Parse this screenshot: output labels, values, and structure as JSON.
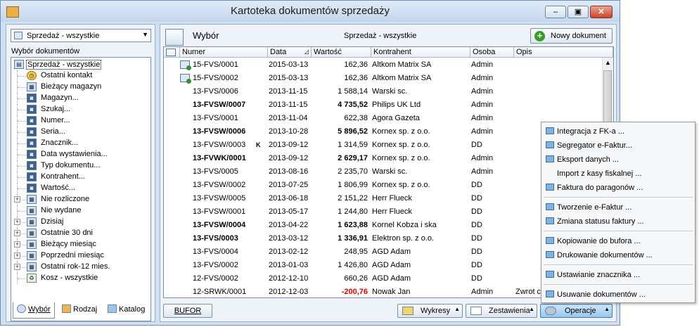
{
  "window": {
    "title": "Kartoteka dokumentów sprzedaży",
    "min_label": "▭",
    "max_label": "□",
    "close_label": "✕"
  },
  "left": {
    "combo_value": "Sprzedaż - wszystkie",
    "section_label": "Wybór dokumentów",
    "tree": [
      {
        "label": "Sprzedaż - wszystkie",
        "icon": "list-icon",
        "selected": true
      },
      {
        "label": "Ostatni kontakt",
        "icon": "clock-icon"
      },
      {
        "label": "Bieżący magazyn",
        "icon": "grid-icon"
      },
      {
        "label": "Magazyn...",
        "icon": "binoculars-icon"
      },
      {
        "label": "Szukaj...",
        "icon": "binoculars-icon"
      },
      {
        "label": "Numer...",
        "icon": "binoculars-icon"
      },
      {
        "label": "Seria...",
        "icon": "binoculars-icon"
      },
      {
        "label": "Znacznik...",
        "icon": "binoculars-icon"
      },
      {
        "label": "Data wystawienia...",
        "icon": "binoculars-icon"
      },
      {
        "label": "Typ dokumentu...",
        "icon": "binoculars-icon"
      },
      {
        "label": "Kontrahent...",
        "icon": "binoculars-icon"
      },
      {
        "label": "Wartość...",
        "icon": "binoculars-icon"
      },
      {
        "label": "Nie rozliczone",
        "icon": "grid-icon",
        "expand": true
      },
      {
        "label": "Nie wydane",
        "icon": "grid-icon"
      },
      {
        "label": "Dzisiaj",
        "icon": "grid-icon",
        "expand": true
      },
      {
        "label": "Ostatnie 30 dni",
        "icon": "grid-icon",
        "expand": true
      },
      {
        "label": "Bieżący miesiąc",
        "icon": "grid-icon",
        "expand": true
      },
      {
        "label": "Poprzedni miesiąc",
        "icon": "grid-icon",
        "expand": true
      },
      {
        "label": "Ostatni rok-12 mies.",
        "icon": "grid-icon",
        "expand": true
      },
      {
        "label": "Kosz - wszystkie",
        "icon": "recycle-bin-icon"
      }
    ],
    "tabs": {
      "wybor": "Wybór",
      "rodzaj": "Rodzaj",
      "katalog": "Katalog"
    }
  },
  "main": {
    "title": "Wybór",
    "subtitle": "Sprzedaż - wszystkie",
    "new_doc_label": "Nowy dokument",
    "columns": [
      "Numer",
      "Data",
      "Wartość",
      "Kontrahent",
      "Osoba",
      "Opis"
    ],
    "rows": [
      {
        "num": "15-FVS/0001",
        "date": "2015-03-13",
        "val": "162,36",
        "kon": "Altkom Matrix SA",
        "os": "Admin",
        "opis": "",
        "bold": false,
        "icon": true
      },
      {
        "num": "15-FVS/0002",
        "date": "2015-03-13",
        "val": "162,36",
        "kon": "Altkom Matrix SA",
        "os": "Admin",
        "opis": "",
        "bold": false,
        "icon": true
      },
      {
        "num": "13-FVS/0006",
        "date": "2013-11-15",
        "val": "1 588,14",
        "kon": "Warski sc.",
        "os": "Admin",
        "opis": "",
        "bold": false
      },
      {
        "num": "13-FVSW/0007",
        "date": "2013-11-15",
        "val": "4 735,52",
        "kon": "Philips UK Ltd",
        "os": "Admin",
        "opis": "",
        "bold": true
      },
      {
        "num": "13-FVS/0001",
        "date": "2013-11-04",
        "val": "622,38",
        "kon": "Agora Gazeta",
        "os": "Admin",
        "opis": "",
        "bold": false
      },
      {
        "num": "13-FVSW/0006",
        "date": "2013-10-28",
        "val": "5 896,52",
        "kon": "Kornex sp. z o.o.",
        "os": "Admin",
        "opis": "",
        "bold": true
      },
      {
        "num": "13-FVSW/0003",
        "date": "2013-09-12",
        "val": "1 314,59",
        "kon": "Kornex sp. z o.o.",
        "os": "DD",
        "opis": "",
        "bold": false,
        "mark": "K"
      },
      {
        "num": "13-FVWK/0001",
        "date": "2013-09-12",
        "val": "2 629,17",
        "kon": "Kornex sp. z o.o.",
        "os": "Admin",
        "opis": "",
        "bold": true
      },
      {
        "num": "13-FVS/0005",
        "date": "2013-08-16",
        "val": "2 235,70",
        "kon": "Warski sc.",
        "os": "Admin",
        "opis": "",
        "bold": false
      },
      {
        "num": "13-FVSW/0002",
        "date": "2013-07-25",
        "val": "1 806,99",
        "kon": "Kornex sp. z o.o.",
        "os": "DD",
        "opis": "",
        "bold": false
      },
      {
        "num": "13-FVSW/0005",
        "date": "2013-06-18",
        "val": "2 151,22",
        "kon": "Herr Flueck",
        "os": "DD",
        "opis": "",
        "bold": false
      },
      {
        "num": "13-FVSW/0001",
        "date": "2013-05-17",
        "val": "1 244,80",
        "kon": "Herr Flueck",
        "os": "DD",
        "opis": "",
        "bold": false
      },
      {
        "num": "13-FVSW/0004",
        "date": "2013-04-22",
        "val": "1 623,88",
        "kon": "Kornel Kobza i ska",
        "os": "DD",
        "opis": "",
        "bold": true
      },
      {
        "num": "13-FVS/0003",
        "date": "2013-03-12",
        "val": "1 336,91",
        "kon": "Elektron sp. z o.o.",
        "os": "DD",
        "opis": "",
        "bold": true
      },
      {
        "num": "13-FVS/0004",
        "date": "2013-02-12",
        "val": "248,95",
        "kon": "AGD Adam",
        "os": "DD",
        "opis": "",
        "bold": false
      },
      {
        "num": "13-FVS/0002",
        "date": "2013-01-03",
        "val": "1 426,80",
        "kon": "AGD Adam",
        "os": "DD",
        "opis": "",
        "bold": false
      },
      {
        "num": "12-FVS/0002",
        "date": "2012-12-10",
        "val": "660,26",
        "kon": "AGD Adam",
        "os": "DD",
        "opis": "",
        "bold": false
      },
      {
        "num": "12-SRWK/0001",
        "date": "2012-12-03",
        "val": "-200,76",
        "kon": "Nowak Jan",
        "os": "Admin",
        "opis": "Zwrot c",
        "bold": false,
        "negative": true
      }
    ],
    "buttons": {
      "bufor": "BUFOR",
      "wykresy": "Wykresy",
      "zestawienia": "Zestawienia",
      "operacje": "Operacje"
    }
  },
  "menu": {
    "items": [
      {
        "label": "Integracja z FK-a ...",
        "icon": true
      },
      {
        "label": "Segregator e-Faktur...",
        "icon": true
      },
      {
        "label": "Eksport danych ...",
        "icon": true
      },
      {
        "label": "Import z kasy fiskalnej ...",
        "icon": false
      },
      {
        "label": "Faktura do paragonów ...",
        "icon": true
      },
      {
        "sep": true
      },
      {
        "label": "Tworzenie e-Faktur ...",
        "icon": true
      },
      {
        "label": "Zmiana statusu faktury ...",
        "icon": true
      },
      {
        "sep": true
      },
      {
        "label": "Kopiowanie do bufora ...",
        "icon": true
      },
      {
        "label": "Drukowanie dokumentów ...",
        "icon": true
      },
      {
        "sep": true
      },
      {
        "label": "Ustawianie znacznika ...",
        "icon": true
      },
      {
        "sep": true
      },
      {
        "label": "Usuwanie dokumentów ...",
        "icon": true
      }
    ]
  }
}
